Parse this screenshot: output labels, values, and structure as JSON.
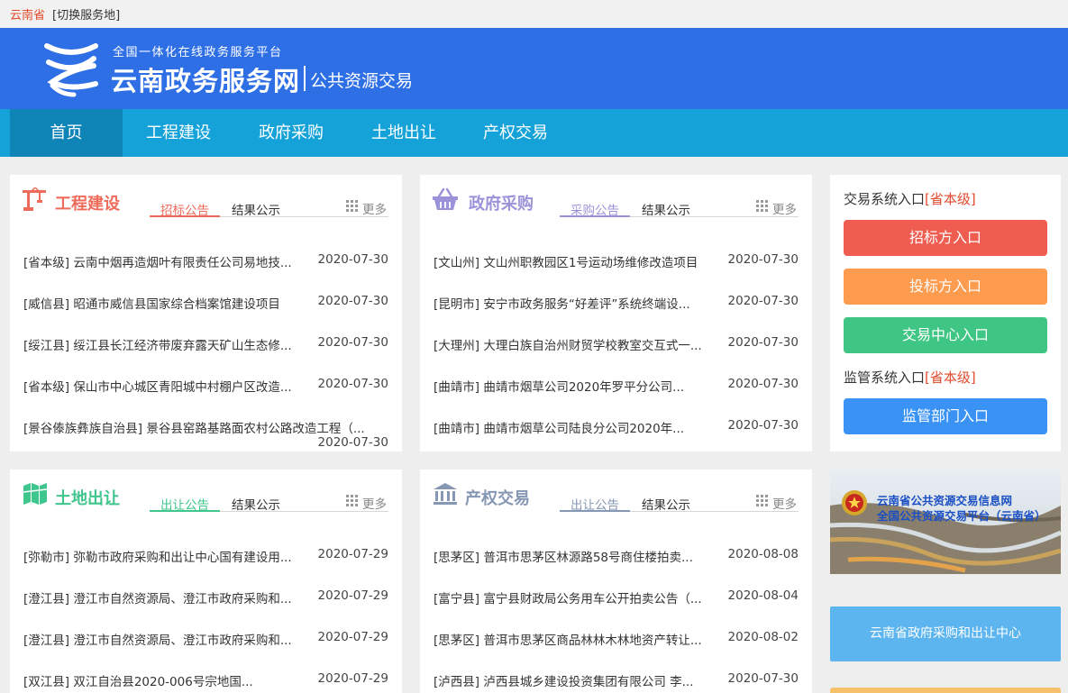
{
  "topbar": {
    "region": "云南省",
    "switch_label": "[切换服务地]"
  },
  "header": {
    "subtitle": "全国一体化在线政务服务平台",
    "title": "云南政务服务网",
    "section": "公共资源交易"
  },
  "nav": [
    "首页",
    "工程建设",
    "政府采购",
    "土地出让",
    "产权交易"
  ],
  "panels": {
    "engineering": {
      "title": "工程建设",
      "tab_active": "招标公告",
      "tab_other": "结果公示",
      "more": "更多",
      "items": [
        {
          "title": "[省本级] 云南中烟再造烟叶有限责任公司易地技...",
          "date": "2020-07-30"
        },
        {
          "title": "[威信县] 昭通市威信县国家综合档案馆建设项目",
          "date": "2020-07-30"
        },
        {
          "title": "[绥江县] 绥江县长江经济带废弃露天矿山生态修...",
          "date": "2020-07-30"
        },
        {
          "title": "[省本级] 保山市中心城区青阳城中村棚户区改造...",
          "date": "2020-07-30"
        },
        {
          "title": "[景谷傣族彝族自治县] 景谷县窑路基路面农村公路改造工程（...",
          "date": "2020-07-30"
        }
      ]
    },
    "procurement": {
      "title": "政府采购",
      "tab_active": "采购公告",
      "tab_other": "结果公示",
      "more": "更多",
      "items": [
        {
          "title": "[文山州] 文山州职教园区1号运动场维修改造项目",
          "date": "2020-07-30"
        },
        {
          "title": "[昆明市] 安宁市政务服务“好差评”系统终端设...",
          "date": "2020-07-30"
        },
        {
          "title": "[大理州] 大理白族自治州财贸学校教室交互式一...",
          "date": "2020-07-30"
        },
        {
          "title": "[曲靖市] 曲靖市烟草公司2020年罗平分公司...",
          "date": "2020-07-30"
        },
        {
          "title": "[曲靖市] 曲靖市烟草公司陆良分公司2020年...",
          "date": "2020-07-30"
        }
      ]
    },
    "land": {
      "title": "土地出让",
      "tab_active": "出让公告",
      "tab_other": "结果公示",
      "more": "更多",
      "items": [
        {
          "title": "[弥勒市] 弥勒市政府采购和出让中心国有建设用...",
          "date": "2020-07-29"
        },
        {
          "title": "[澄江县] 澄江市自然资源局、澄江市政府采购和...",
          "date": "2020-07-29"
        },
        {
          "title": "[澄江县] 澄江市自然资源局、澄江市政府采购和...",
          "date": "2020-07-29"
        },
        {
          "title": "[双江县] 双江自治县2020-006号宗地国...",
          "date": "2020-07-29"
        }
      ]
    },
    "property": {
      "title": "产权交易",
      "tab_active": "出让公告",
      "tab_other": "结果公示",
      "more": "更多",
      "items": [
        {
          "title": "[思茅区] 普洱市思茅区林源路58号商住楼拍卖...",
          "date": "2020-08-08"
        },
        {
          "title": "[富宁县] 富宁县财政局公务用车公开拍卖公告（...",
          "date": "2020-08-04"
        },
        {
          "title": "[思茅区] 普洱市思茅区商品林林木林地资产转让...",
          "date": "2020-08-02"
        },
        {
          "title": "[泸西县] 泸西县城乡建设投资集团有限公司 李...",
          "date": "2020-07-30"
        }
      ]
    }
  },
  "sidebar": {
    "trade_label": "交易系统入口",
    "trade_level": "[省本级]",
    "btn_tenderer": "招标方入口",
    "btn_bidder": "投标方入口",
    "btn_center": "交易中心入口",
    "supervise_label": "监管系统入口",
    "supervise_level": "[省本级]",
    "btn_supervise": "监管部门入口",
    "banner_line1": "云南省公共资源交易信息网",
    "banner_line2": "全国公共资源交易平台（云南省）",
    "link_center": "云南省政府采购和出让中心"
  },
  "colors": {
    "header_blue": "#2f6fe6",
    "nav_cyan": "#14a2d8",
    "nav_active": "#0e84b7",
    "eng_red": "#ee6a5a",
    "proc_purple": "#9b93d9",
    "land_green": "#3fc68c",
    "prop_slate": "#8597b3",
    "btn_red": "#ef5c50",
    "btn_orange": "#fd9b4f",
    "btn_green": "#3fc684",
    "btn_blue": "#3a93f4"
  },
  "icons": [
    "logo-mark",
    "crane-icon",
    "basket-icon",
    "land-map-icon",
    "bank-building-icon",
    "grid-icon",
    "national-emblem-icon"
  ]
}
